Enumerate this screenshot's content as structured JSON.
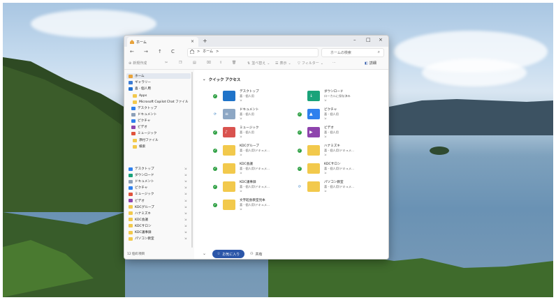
{
  "window": {
    "tab_title": "ホーム",
    "tab_close": "×",
    "new_tab": "+",
    "minimize": "–",
    "maximize": "□",
    "close": "×"
  },
  "nav": {
    "back": "←",
    "forward": "→",
    "up": "↑",
    "refresh": "C",
    "breadcrumb_home": "ホーム",
    "breadcrumb_sep": ">",
    "breadcrumb_more": ">",
    "search_placeholder": "ホームの検索",
    "search_icon": "search-icon"
  },
  "commandbar": {
    "new_label": "新規作成",
    "sort_label": "並べ替え",
    "view_label": "表示",
    "filter_label": "フィルター",
    "more_label": "···",
    "details_label": "詳細"
  },
  "sidebar": {
    "top_items": [
      {
        "label": "ホーム",
        "color": "#e8a33c",
        "selected": true
      },
      {
        "label": "ギャラリー",
        "color": "#3b7bd4"
      },
      {
        "label": "喜 - 個人用",
        "color": "#1f6fd1"
      },
      {
        "label": "Apps",
        "color": "#f2c94c"
      },
      {
        "label": "Microsoft Copilot Chat ファイル",
        "color": "#f2c94c"
      },
      {
        "label": "デスクトップ",
        "color": "#2f80ed"
      },
      {
        "label": "ドキュメント",
        "color": "#8da0b8"
      },
      {
        "label": "ピクチャ",
        "color": "#2f80ed"
      },
      {
        "label": "ビデオ",
        "color": "#8e44ad"
      },
      {
        "label": "ミュージック",
        "color": "#e0523c"
      },
      {
        "label": "添付ファイル",
        "color": "#f2c94c"
      },
      {
        "label": "検索",
        "color": "#f2c94c"
      }
    ],
    "pinned_items": [
      {
        "label": "デスクトップ",
        "color": "#2f80ed"
      },
      {
        "label": "ダウンロード",
        "color": "#1aa37a"
      },
      {
        "label": "ドキュメント",
        "color": "#8da0b8"
      },
      {
        "label": "ピクチャ",
        "color": "#2f80ed"
      },
      {
        "label": "ミュージック",
        "color": "#e0523c"
      },
      {
        "label": "ビデオ",
        "color": "#8e44ad"
      },
      {
        "label": "KDCグループ",
        "color": "#f2c94c"
      },
      {
        "label": "ハナミズキ",
        "color": "#f2c94c"
      },
      {
        "label": "KDC会議",
        "color": "#f2c94c"
      },
      {
        "label": "KDCサロン",
        "color": "#f2c94c"
      },
      {
        "label": "KDC議事録",
        "color": "#f2c94c"
      },
      {
        "label": "パソコン教室",
        "color": "#f2c94c"
      }
    ],
    "pin_glyph": "⇲",
    "status_text": "12 個の項目"
  },
  "quick_access": {
    "heading": "クイック アクセス",
    "items": [
      {
        "name": "デスクトップ",
        "sub": "喜 - 個人用",
        "folder": "#1f73c9",
        "symbol": "",
        "status": "#2ea043",
        "status_glyph": "✓"
      },
      {
        "name": "ダウンロード",
        "sub": "ローカルに保存済み",
        "folder": "#1aa37a",
        "symbol": "↓",
        "status": "",
        "status_glyph": ""
      },
      {
        "name": "ドキュメント",
        "sub": "喜 - 個人用",
        "folder": "#8da7c4",
        "symbol": "≡",
        "status": "#3b82c4",
        "status_glyph": "⟳"
      },
      {
        "name": "ピクチャ",
        "sub": "喜 - 個人用",
        "folder": "#2f80ed",
        "symbol": "▲",
        "status": "#2ea043",
        "status_glyph": "✓"
      },
      {
        "name": "ミュージック",
        "sub": "喜 - 個人用",
        "folder": "#d9534f",
        "symbol": "♪",
        "status": "#2ea043",
        "status_glyph": "✓"
      },
      {
        "name": "ビデオ",
        "sub": "喜 - 個人用",
        "folder": "#8e44ad",
        "symbol": "▶",
        "status": "#2ea043",
        "status_glyph": "✓"
      },
      {
        "name": "KDCグループ",
        "sub": "喜 - 個人用\\ドキュメ...",
        "folder": "#f2c94c",
        "symbol": "",
        "status": "#2ea043",
        "status_glyph": "✓"
      },
      {
        "name": "ハナミズキ",
        "sub": "喜 - 個人用\\ドキュメ...",
        "folder": "#f2c94c",
        "symbol": "",
        "status": "#2ea043",
        "status_glyph": "✓"
      },
      {
        "name": "KDC会議",
        "sub": "喜 - 個人用\\ドキュメ...",
        "folder": "#f2c94c",
        "symbol": "",
        "status": "#2ea043",
        "status_glyph": "✓"
      },
      {
        "name": "KDCサロン",
        "sub": "喜 - 個人用\\ドキュメ...",
        "folder": "#f2c94c",
        "symbol": "",
        "status": "#2ea043",
        "status_glyph": "✓"
      },
      {
        "name": "KDC議事録",
        "sub": "喜 - 個人用\\ドキュメ...",
        "folder": "#f2c94c",
        "symbol": "",
        "status": "#2ea043",
        "status_glyph": "✓"
      },
      {
        "name": "パソコン教室",
        "sub": "喜 - 個人用\\ドキュメ...",
        "folder": "#f2c94c",
        "symbol": "",
        "status": "#3b82c4",
        "status_glyph": "⟳"
      },
      {
        "name": "文字起会教室見本",
        "sub": "喜 - 個人用\\ドキュメ...",
        "folder": "#f2c94c",
        "symbol": "",
        "status": "#2ea043",
        "status_glyph": "✓"
      }
    ],
    "pin_glyph": "⇲"
  },
  "footer_tabs": {
    "favorites": "お気に入り",
    "shared": "共有"
  }
}
